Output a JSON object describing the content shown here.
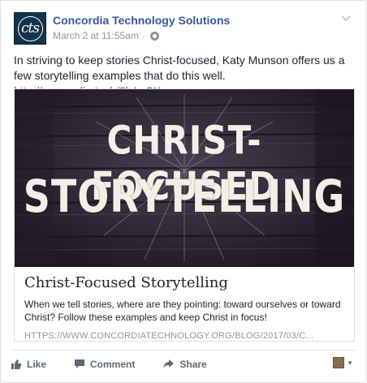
{
  "post": {
    "page_name": "Concordia Technology Solutions",
    "avatar_text": "cts",
    "timestamp": "March 2 at 11:55am",
    "separator": "·",
    "text": "In striving to keep stories Christ-focused, Katy Munson offers us a few storytelling examples that do this well.",
    "link": "http://concordia.tech/2lxLzSK"
  },
  "attachment": {
    "hero_line1": "CHRIST-FOCUSED",
    "hero_line2": "STORYTELLING",
    "title": "Christ-Focused Storytelling",
    "description": "When we tell stories, where are they pointing: toward ourselves or toward Christ? Follow these examples and keep Christ in focus!",
    "url": "HTTPS://WWW.CONCORDIATECHNOLOGY.ORG/BLOG/2017/03/C..."
  },
  "actions": {
    "like": "Like",
    "comment": "Comment",
    "share": "Share"
  },
  "icons": {
    "like": "thumbs-up-icon",
    "comment": "comment-bubble-icon",
    "share": "share-arrow-icon",
    "privacy": "globe-icon",
    "menu": "chevron-down-icon"
  },
  "colors": {
    "link": "#365899",
    "meta": "#90949c",
    "action": "#616770",
    "avatar_bg": "#13324b"
  }
}
